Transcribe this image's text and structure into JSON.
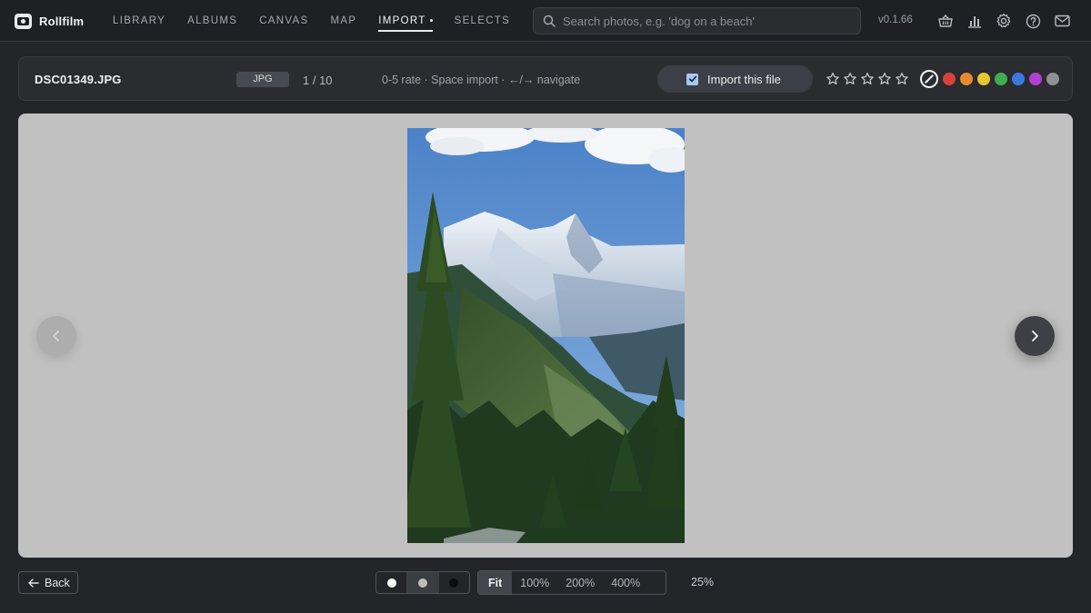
{
  "app": {
    "name": "Rollfilm",
    "version": "v0.1.66"
  },
  "nav": {
    "items": [
      {
        "label": "LIBRARY"
      },
      {
        "label": "ALBUMS"
      },
      {
        "label": "CANVAS"
      },
      {
        "label": "MAP"
      },
      {
        "label": "IMPORT",
        "active": true
      },
      {
        "label": "SELECTS"
      }
    ]
  },
  "search": {
    "placeholder": "Search photos, e.g. 'dog on a beach'",
    "value": ""
  },
  "top_icons": [
    "basket-icon",
    "stats-icon",
    "gear-icon",
    "help-icon",
    "mail-icon"
  ],
  "file": {
    "name": "DSC01349.JPG",
    "type": "JPG",
    "counter": "1 / 10",
    "hint": "0-5 rate · Space import · ←/→ navigate",
    "import_label": "Import this file",
    "import_checked": true,
    "rating": 0,
    "rating_max": 5
  },
  "color_labels": {
    "selected": "none",
    "swatches": [
      "#d9413b",
      "#e8892d",
      "#e6c72f",
      "#3fae4f",
      "#3d78e0",
      "#b33fd4",
      "#8e9095"
    ]
  },
  "viewer": {
    "photo_description": "mountain-landscape-photo",
    "background": "#c1c1c1"
  },
  "bottom": {
    "back_label": "Back",
    "background_options": [
      {
        "name": "white",
        "color": "#ffffff"
      },
      {
        "name": "gray",
        "color": "#bdbdbd",
        "selected": true
      },
      {
        "name": "black",
        "color": "#0c0c0c"
      }
    ],
    "zoom_options": [
      {
        "label": "Fit",
        "selected": true
      },
      {
        "label": "100%"
      },
      {
        "label": "200%"
      },
      {
        "label": "400%"
      }
    ],
    "zoom_level": "25%"
  }
}
